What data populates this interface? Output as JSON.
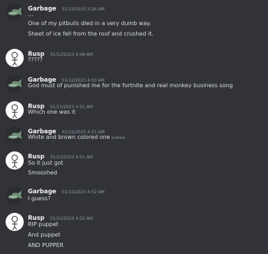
{
  "messages": [
    {
      "author": "Garbage",
      "avatar": "garbage-avatar",
      "time": "01/12/2023 3:26 AM",
      "lines": [
        "...",
        "One of my pitbulls died in a very dumb way.",
        "Sheet of ice fell from the roof and crushed it."
      ]
    },
    {
      "author": "Rusp",
      "avatar": "rusp-avatar",
      "time": "01/12/2023 4:48 AM",
      "lines": [
        "?????"
      ]
    },
    {
      "author": "Garbage",
      "avatar": "garbage-avatar",
      "time": "01/12/2023 4:50 AM",
      "lines": [
        "God must of punished me for the fortnite and real monkey business song"
      ]
    },
    {
      "author": "Rusp",
      "avatar": "rusp-avatar",
      "time": "01/12/2023 4:51 AM",
      "lines": [
        "Which one was it"
      ]
    },
    {
      "author": "Garbage",
      "avatar": "garbage-avatar",
      "time": "01/12/2023 4:51 AM",
      "lines": [
        "White and brown colored one"
      ],
      "edited": "(edited)"
    },
    {
      "author": "Rusp",
      "avatar": "rusp-avatar",
      "time": "01/12/2023 4:51 AM",
      "lines": [
        "So it just got",
        "Smooshed"
      ]
    },
    {
      "author": "Garbage",
      "avatar": "garbage-avatar",
      "time": "01/12/2023 4:52 AM",
      "lines": [
        "I guess?"
      ]
    },
    {
      "author": "Rusp",
      "avatar": "rusp-avatar",
      "time": "01/12/2023 4:52 AM",
      "lines": [
        "RIP puppet",
        "And puppet",
        "AND PUPPER"
      ]
    }
  ],
  "colors": {
    "background": "#313338",
    "author": "#f2f3f5",
    "timestamp": "#949ba4",
    "text": "#dbdee1"
  }
}
